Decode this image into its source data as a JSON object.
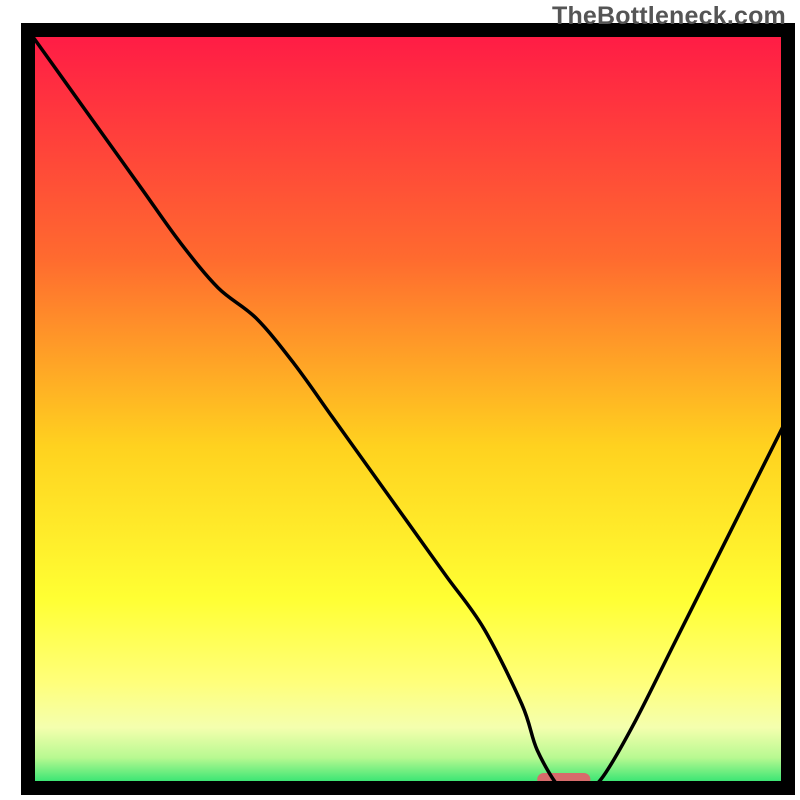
{
  "watermark": "TheBottleneck.com",
  "chart_data": {
    "type": "line",
    "title": "",
    "xlabel": "",
    "ylabel": "",
    "xlim": [
      0,
      100
    ],
    "ylim": [
      0,
      100
    ],
    "x": [
      0,
      5,
      10,
      15,
      20,
      25,
      30,
      35,
      40,
      45,
      50,
      55,
      60,
      65,
      67,
      70,
      72,
      74,
      76,
      80,
      85,
      90,
      95,
      100
    ],
    "values": [
      100,
      93,
      86,
      79,
      72,
      66,
      62,
      56,
      49,
      42,
      35,
      28,
      21,
      11,
      5,
      0,
      0,
      0,
      2,
      9,
      19,
      29,
      39,
      49
    ],
    "gradient_stops": [
      {
        "offset": 0,
        "color": "#ff1a46"
      },
      {
        "offset": 30,
        "color": "#ff6a2f"
      },
      {
        "offset": 55,
        "color": "#ffd21f"
      },
      {
        "offset": 75,
        "color": "#ffff33"
      },
      {
        "offset": 86,
        "color": "#ffff7a"
      },
      {
        "offset": 92,
        "color": "#f4ffae"
      },
      {
        "offset": 96,
        "color": "#b8f991"
      },
      {
        "offset": 100,
        "color": "#18e06c"
      }
    ],
    "optimum_bar": {
      "x_start": 67,
      "x_end": 74,
      "color": "#d76b6b"
    },
    "frame_color": "#000000",
    "line_color": "#000000"
  }
}
